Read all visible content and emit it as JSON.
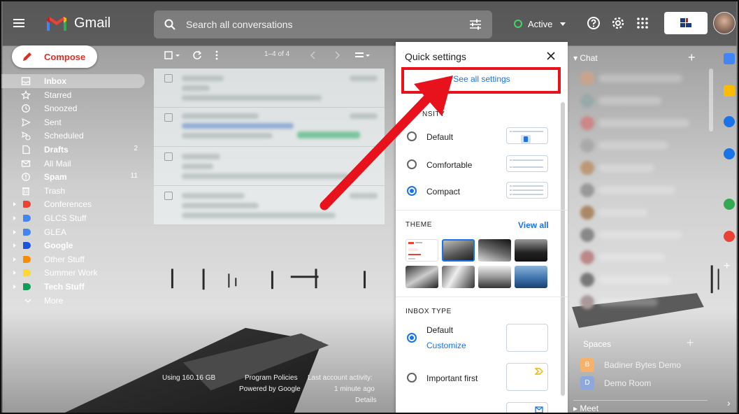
{
  "app": {
    "name": "Gmail"
  },
  "search": {
    "placeholder": "Search all conversations"
  },
  "status": {
    "label": "Active",
    "color": "#42d66a"
  },
  "compose": {
    "label": "Compose"
  },
  "nav": {
    "items": [
      {
        "label": "Inbox",
        "icon": "inbox-icon",
        "active": true,
        "bold": true,
        "count": ""
      },
      {
        "label": "Starred",
        "icon": "star-icon",
        "count": ""
      },
      {
        "label": "Snoozed",
        "icon": "clock-icon",
        "count": ""
      },
      {
        "label": "Sent",
        "icon": "send-icon",
        "count": ""
      },
      {
        "label": "Scheduled",
        "icon": "scheduled-send-icon",
        "count": ""
      },
      {
        "label": "Drafts",
        "icon": "draft-icon",
        "bold": true,
        "count": "2"
      },
      {
        "label": "All Mail",
        "icon": "all-mail-icon",
        "count": ""
      },
      {
        "label": "Spam",
        "icon": "spam-icon",
        "bold": true,
        "count": "11"
      },
      {
        "label": "Trash",
        "icon": "trash-icon",
        "count": ""
      },
      {
        "label": "Conferences",
        "tag": "#ea4335",
        "count": ""
      },
      {
        "label": "GLCS Stuff",
        "tag": "#4285f4",
        "count": ""
      },
      {
        "label": "GLEA",
        "tag": "#4285f4",
        "count": ""
      },
      {
        "label": "Google",
        "tag": "#1a56db",
        "bold": true,
        "count": ""
      },
      {
        "label": "Other Stuff",
        "tag": "#fb8c00",
        "count": ""
      },
      {
        "label": "Summer Work",
        "tag": "#fdd835",
        "count": ""
      },
      {
        "label": "Tech Stuff",
        "tag": "#0f9d58",
        "bold": true,
        "count": ""
      },
      {
        "label": "More",
        "icon": "chevron-down-icon",
        "count": ""
      }
    ]
  },
  "mail": {
    "page_count": "1–4 of 4"
  },
  "footer": {
    "storage": "Using 160.16 GB",
    "policies": "Program Policies",
    "powered": "Powered by Google",
    "activity": "Last account activity:",
    "activity_time": "1 minute ago",
    "details": "Details"
  },
  "quick_settings": {
    "title": "Quick settings",
    "see_all": "See all settings",
    "density": {
      "heading": "NSITY",
      "options": [
        {
          "label": "Default",
          "selected": false
        },
        {
          "label": "Comfortable",
          "selected": false
        },
        {
          "label": "Compact",
          "selected": true
        }
      ]
    },
    "theme": {
      "heading": "THEME",
      "view_all": "View all"
    },
    "inbox_type": {
      "heading": "INBOX TYPE",
      "options": [
        {
          "label": "Default",
          "selected": true,
          "link": "Customize"
        },
        {
          "label": "Important first",
          "selected": false
        }
      ]
    }
  },
  "chat": {
    "heading": "Chat",
    "spaces_heading": "Spaces",
    "spaces": [
      {
        "initial": "B",
        "label": "Badiner Bytes Demo",
        "color": "#f6b26b"
      },
      {
        "initial": "D",
        "label": "Demo Room",
        "color": "#8fa8dc"
      }
    ],
    "meet": "Meet"
  },
  "colors": {
    "accent": "#1a73e8",
    "compose_text": "#d93025",
    "highlight": "#e8121c"
  }
}
